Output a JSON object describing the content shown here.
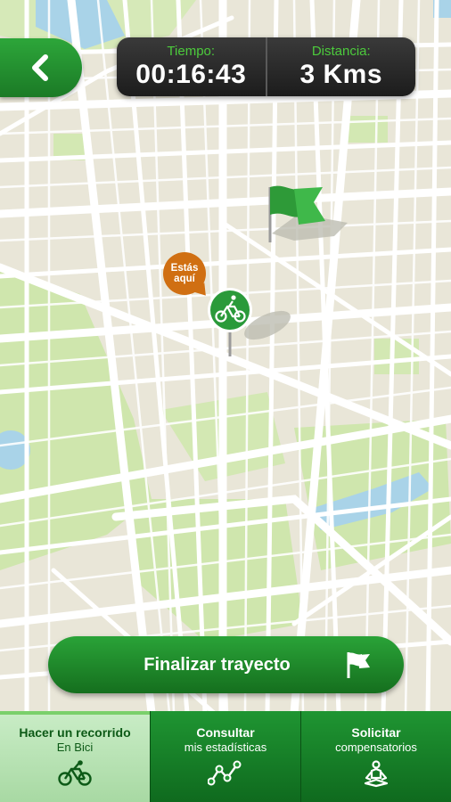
{
  "header": {
    "back_icon": "chevron-left-icon",
    "time_label": "Tiempo:",
    "time_value": "00:16:43",
    "distance_label": "Distancia:",
    "distance_value": "3 Kms"
  },
  "map": {
    "you_are_here_line1": "Estás",
    "you_are_here_line2": "aquí",
    "rider_icon": "bicycle-icon",
    "destination_icon": "flag-icon"
  },
  "finish_button": {
    "label": "Finalizar trayecto",
    "icon": "flag-icon"
  },
  "tabs": [
    {
      "title": "Hacer un recorrido",
      "subtitle": "En Bici",
      "icon": "bicycle-icon",
      "active": true
    },
    {
      "title": "Consultar",
      "subtitle": "mis estadísticas",
      "icon": "stats-line-icon",
      "active": false
    },
    {
      "title": "Solicitar",
      "subtitle": "compensatorios",
      "icon": "meditation-icon",
      "active": false
    }
  ],
  "colors": {
    "brand_green": "#1f9532",
    "stat_green": "#4ccb3c",
    "marker_orange": "#d06f12",
    "map_land": "#e9e6d8",
    "park": "#c9e4a4",
    "water": "#a9d3e8"
  }
}
